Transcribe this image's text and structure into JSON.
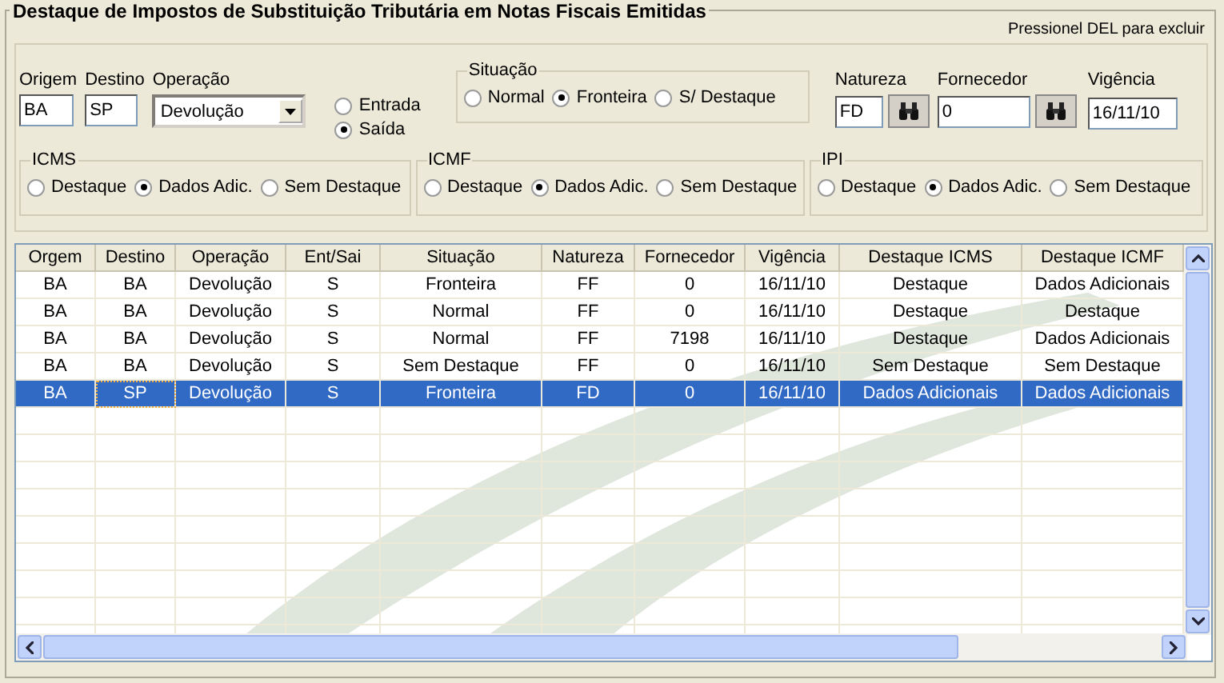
{
  "title": "Destaque de Impostos de Substituição Tributária em Notas Fiscais Emitidas",
  "hint": "Pressionel DEL para excluir",
  "form": {
    "origem": {
      "label": "Origem",
      "value": "BA"
    },
    "destino": {
      "label": "Destino",
      "value": "SP"
    },
    "operacao": {
      "label": "Operação",
      "value": "Devolução"
    },
    "direction": [
      {
        "label": "Entrada",
        "selected": false
      },
      {
        "label": "Saída",
        "selected": true
      }
    ],
    "situacao": {
      "title": "Situação",
      "options": [
        {
          "label": "Normal",
          "selected": false
        },
        {
          "label": "Fronteira",
          "selected": true
        },
        {
          "label": "S/ Destaque",
          "selected": false
        }
      ]
    },
    "natureza": {
      "label": "Natureza",
      "value": "FD"
    },
    "fornecedor": {
      "label": "Fornecedor",
      "value": "0"
    },
    "vigencia": {
      "label": "Vigência",
      "value": "16/11/10"
    },
    "groups": [
      {
        "title": "ICMS",
        "options": [
          {
            "label": "Destaque",
            "selected": false
          },
          {
            "label": "Dados Adic.",
            "selected": true
          },
          {
            "label": "Sem Destaque",
            "selected": false
          }
        ]
      },
      {
        "title": "ICMF",
        "options": [
          {
            "label": "Destaque",
            "selected": false
          },
          {
            "label": "Dados Adic.",
            "selected": true
          },
          {
            "label": "Sem Destaque",
            "selected": false
          }
        ]
      },
      {
        "title": "IPI",
        "options": [
          {
            "label": "Destaque",
            "selected": false
          },
          {
            "label": "Dados Adic.",
            "selected": true
          },
          {
            "label": "Sem Destaque",
            "selected": false
          }
        ]
      }
    ]
  },
  "table": {
    "columns": [
      "Orgem",
      "Destino",
      "Operação",
      "Ent/Sai",
      "Situação",
      "Natureza",
      "Fornecedor",
      "Vigência",
      "Destaque ICMS",
      "Destaque ICMF"
    ],
    "rows": [
      {
        "selected": false,
        "cells": [
          {
            "text": "BA",
            "focused": false
          },
          {
            "text": "BA",
            "focused": false
          },
          {
            "text": "Devolução",
            "focused": false
          },
          {
            "text": "S",
            "focused": false
          },
          {
            "text": "Fronteira",
            "focused": false
          },
          {
            "text": "FF",
            "focused": false
          },
          {
            "text": "0",
            "focused": false
          },
          {
            "text": "16/11/10",
            "focused": false
          },
          {
            "text": "Destaque",
            "focused": false
          },
          {
            "text": "Dados Adicionais",
            "focused": false
          }
        ]
      },
      {
        "selected": false,
        "cells": [
          {
            "text": "BA",
            "focused": false
          },
          {
            "text": "BA",
            "focused": false
          },
          {
            "text": "Devolução",
            "focused": false
          },
          {
            "text": "S",
            "focused": false
          },
          {
            "text": "Normal",
            "focused": false
          },
          {
            "text": "FF",
            "focused": false
          },
          {
            "text": "0",
            "focused": false
          },
          {
            "text": "16/11/10",
            "focused": false
          },
          {
            "text": "Destaque",
            "focused": false
          },
          {
            "text": "Destaque",
            "focused": false
          }
        ]
      },
      {
        "selected": false,
        "cells": [
          {
            "text": "BA",
            "focused": false
          },
          {
            "text": "BA",
            "focused": false
          },
          {
            "text": "Devolução",
            "focused": false
          },
          {
            "text": "S",
            "focused": false
          },
          {
            "text": "Normal",
            "focused": false
          },
          {
            "text": "FF",
            "focused": false
          },
          {
            "text": "7198",
            "focused": false
          },
          {
            "text": "16/11/10",
            "focused": false
          },
          {
            "text": "Destaque",
            "focused": false
          },
          {
            "text": "Dados Adicionais",
            "focused": false
          }
        ]
      },
      {
        "selected": false,
        "cells": [
          {
            "text": "BA",
            "focused": false
          },
          {
            "text": "BA",
            "focused": false
          },
          {
            "text": "Devolução",
            "focused": false
          },
          {
            "text": "S",
            "focused": false
          },
          {
            "text": "Sem Destaque",
            "focused": false
          },
          {
            "text": "FF",
            "focused": false
          },
          {
            "text": "0",
            "focused": false
          },
          {
            "text": "16/11/10",
            "focused": false
          },
          {
            "text": "Sem Destaque",
            "focused": false
          },
          {
            "text": "Sem Destaque",
            "focused": false
          }
        ]
      },
      {
        "selected": true,
        "cells": [
          {
            "text": "BA",
            "focused": false
          },
          {
            "text": "SP",
            "focused": true
          },
          {
            "text": "Devolução",
            "focused": false
          },
          {
            "text": "S",
            "focused": false
          },
          {
            "text": "Fronteira",
            "focused": false
          },
          {
            "text": "FD",
            "focused": false
          },
          {
            "text": "0",
            "focused": false
          },
          {
            "text": "16/11/10",
            "focused": false
          },
          {
            "text": "Dados Adicionais",
            "focused": false
          },
          {
            "text": "Dados Adicionais",
            "focused": false
          }
        ]
      }
    ]
  }
}
